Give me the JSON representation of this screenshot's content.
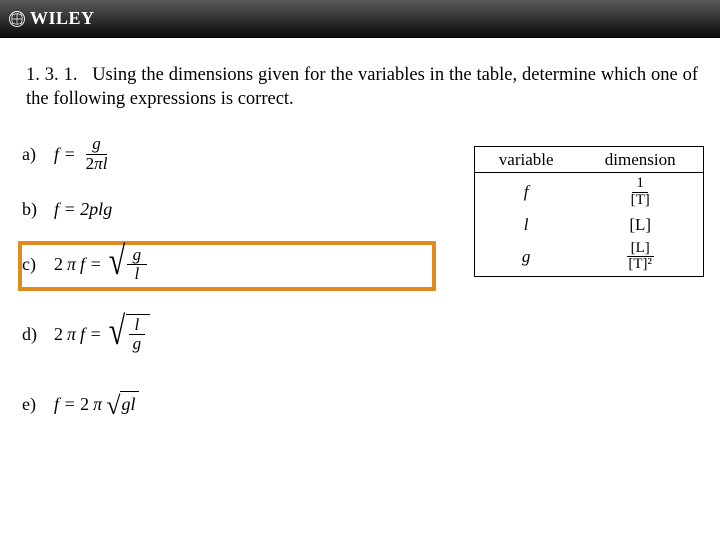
{
  "brand": {
    "name": "WILEY"
  },
  "question": {
    "number": "1. 3. 1.",
    "text": "Using the dimensions given for the variables in the table, determine which one of the following expressions is correct."
  },
  "options": {
    "a": {
      "label": "a)"
    },
    "b": {
      "label": "b)",
      "text": "f = 2plg"
    },
    "c": {
      "label": "c)"
    },
    "d": {
      "label": "d)"
    },
    "e": {
      "label": "e)"
    }
  },
  "formula": {
    "a_lhs": "f =",
    "a_num": "g",
    "a_den_left": "2",
    "a_den_pi": "π",
    "a_den_right": "l",
    "c_lhs_two": "2",
    "c_lhs_pi": "π",
    "c_lhs_f": "f =",
    "c_num": "g",
    "c_den": "l",
    "d_lhs_two": "2",
    "d_lhs_pi": "π",
    "d_lhs_f": "f =",
    "d_num": "l",
    "d_den": "g",
    "e_lhs": "f = 2",
    "e_pi": "π",
    "e_body": "gl"
  },
  "table": {
    "h1": "variable",
    "h2": "dimension",
    "rows": [
      {
        "var": "f",
        "dim_num": "1",
        "dim_den": "[T]"
      },
      {
        "var": "l",
        "dim": "[L]"
      },
      {
        "var": "g",
        "dim_num": "[L]",
        "dim_den": "[T]²"
      }
    ]
  },
  "highlighted": "c"
}
